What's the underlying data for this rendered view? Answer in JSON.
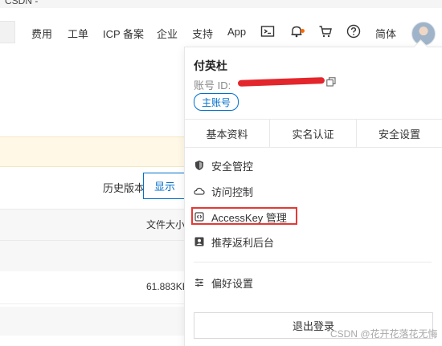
{
  "window": {
    "top_strip_text": "CSDN -"
  },
  "navbar": {
    "items": [
      {
        "label": "费用"
      },
      {
        "label": "工单"
      },
      {
        "label": "ICP 备案"
      },
      {
        "label": "企业"
      },
      {
        "label": "支持"
      },
      {
        "label": "App"
      }
    ],
    "icons": [
      "terminal-icon",
      "bell-icon",
      "cart-icon",
      "help-icon"
    ],
    "language": "简体",
    "notification_dot_color": "#ff6a00"
  },
  "background_page": {
    "history_label": "历史版本",
    "show_button": "显示",
    "table": {
      "header_file_size": "文件大小",
      "row_file_size": "61.883KB"
    }
  },
  "account_menu": {
    "user_name": "付英杜",
    "account_id_label": "账号 ID:",
    "account_type_badge": "主账号",
    "tabs": [
      {
        "label": "基本资料"
      },
      {
        "label": "实名认证"
      },
      {
        "label": "安全设置"
      }
    ],
    "items": [
      {
        "label": "安全管控",
        "icon": "shield-icon"
      },
      {
        "label": "访问控制",
        "icon": "cloud-icon"
      },
      {
        "label": "AccessKey 管理",
        "icon": "key-icon",
        "highlighted": true
      },
      {
        "label": "推荐返利后台",
        "icon": "user-card-icon"
      }
    ],
    "preference_item": {
      "label": "偏好设置",
      "icon": "sliders-icon"
    },
    "logout_label": "退出登录",
    "accent_color": "#0070cc",
    "highlight_color": "#e53935"
  },
  "watermark": "CSDN @花开花落花无悔"
}
